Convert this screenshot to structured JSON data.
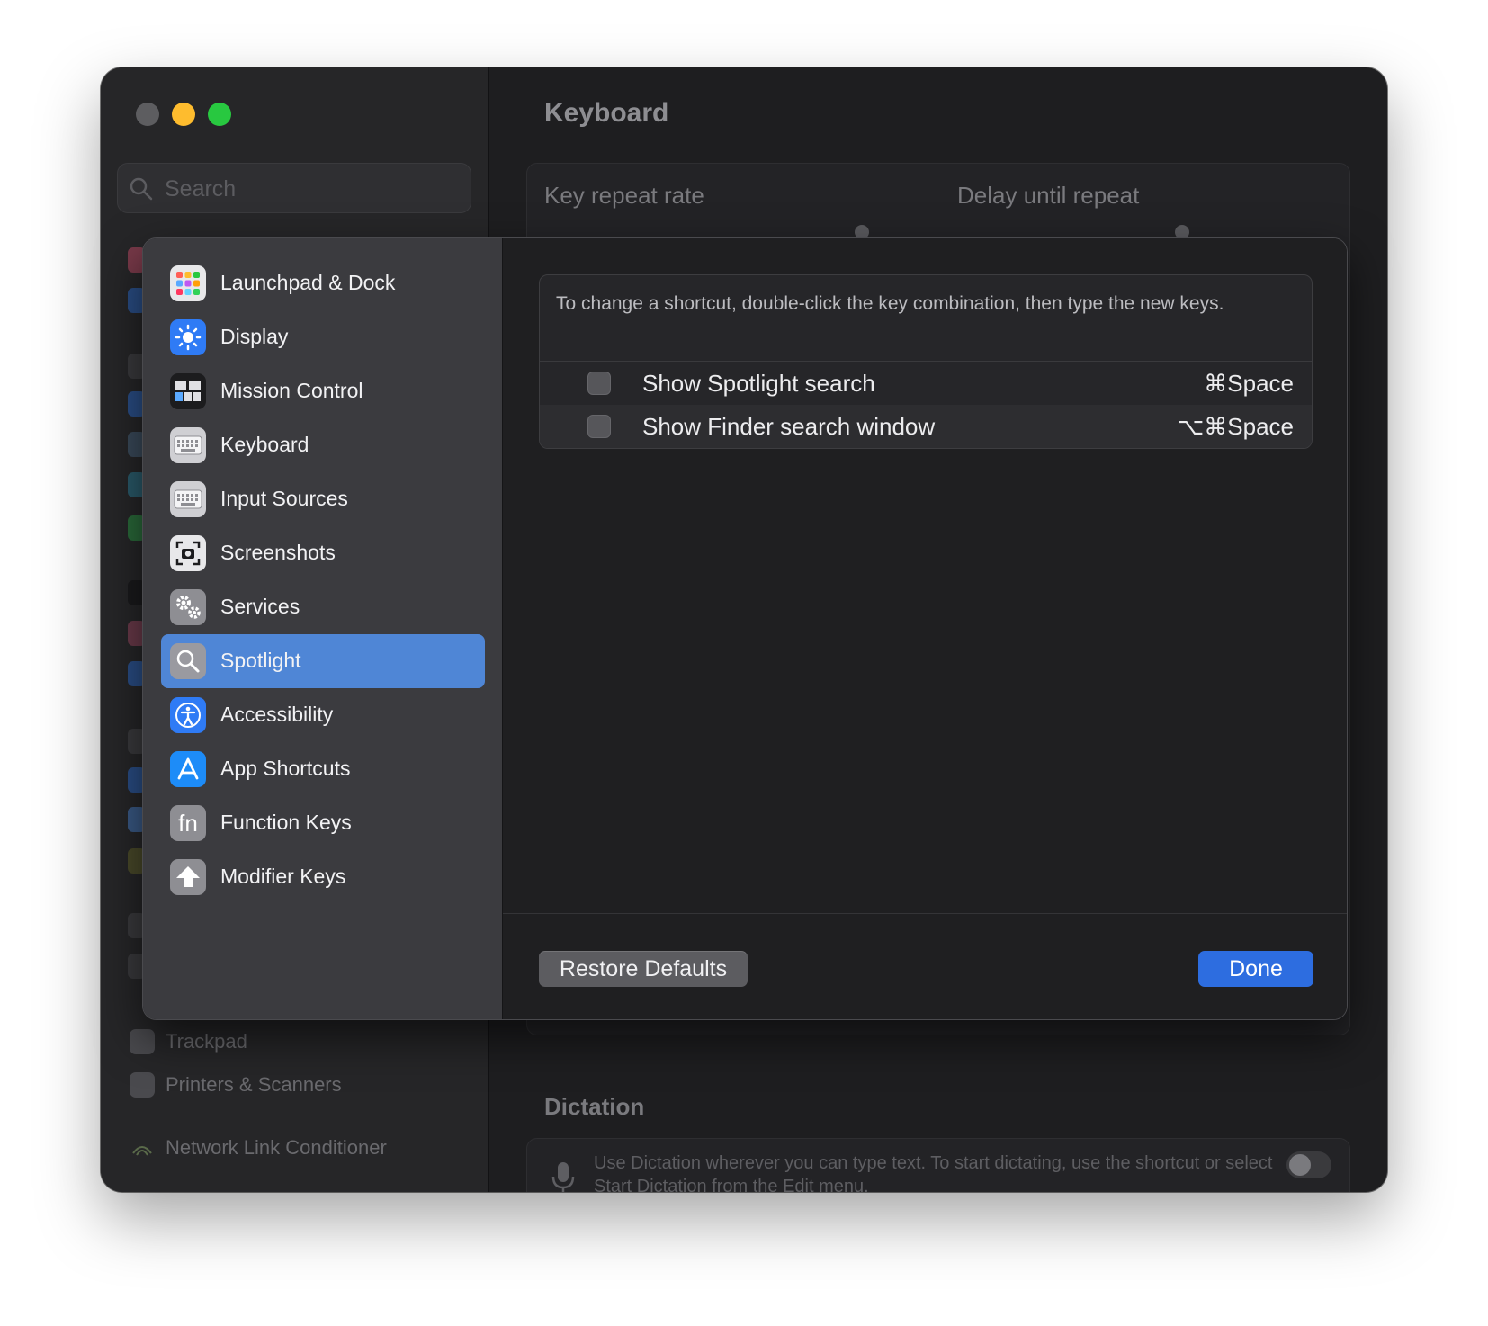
{
  "background_window": {
    "search_placeholder": "Search",
    "title": "Keyboard",
    "key_repeat_label": "Key repeat rate",
    "delay_label": "Delay until repeat",
    "sidebar_items": [
      {
        "label": "Trackpad",
        "icon": "trackpad-icon"
      },
      {
        "label": "Printers & Scanners",
        "icon": "printer-icon"
      },
      {
        "label": "Network Link Conditioner",
        "icon": "network-icon"
      }
    ],
    "dictation_title": "Dictation",
    "dictation_text": "Use Dictation wherever you can type text. To start dictating, use the shortcut or select Start Dictation from the Edit menu."
  },
  "sheet": {
    "sidebar_items": [
      {
        "label": "Launchpad & Dock",
        "icon": "launchpad-icon",
        "selected": false
      },
      {
        "label": "Display",
        "icon": "display-icon",
        "selected": false
      },
      {
        "label": "Mission Control",
        "icon": "mission-control-icon",
        "selected": false
      },
      {
        "label": "Keyboard",
        "icon": "keyboard-icon",
        "selected": false
      },
      {
        "label": "Input Sources",
        "icon": "input-sources-icon",
        "selected": false
      },
      {
        "label": "Screenshots",
        "icon": "screenshot-icon",
        "selected": false
      },
      {
        "label": "Services",
        "icon": "gears-icon",
        "selected": false
      },
      {
        "label": "Spotlight",
        "icon": "spotlight-icon",
        "selected": true
      },
      {
        "label": "Accessibility",
        "icon": "accessibility-icon",
        "selected": false
      },
      {
        "label": "App Shortcuts",
        "icon": "app-store-icon",
        "selected": false
      },
      {
        "label": "Function Keys",
        "icon": "fn-icon",
        "selected": false
      },
      {
        "label": "Modifier Keys",
        "icon": "shift-arrow-icon",
        "selected": false
      }
    ],
    "note": "To change a shortcut, double-click the key combination, then type the new keys.",
    "shortcuts": [
      {
        "label": "Show Spotlight search",
        "keys": "⌘Space",
        "checked": false
      },
      {
        "label": "Show Finder search window",
        "keys": "⌥⌘Space",
        "checked": false
      }
    ],
    "restore_label": "Restore Defaults",
    "done_label": "Done"
  },
  "colors": {
    "selection": "#4f86d6",
    "done_button": "#2d6de0",
    "close": "#5d5d60",
    "minimize": "#febc2e",
    "zoom": "#28c840"
  }
}
